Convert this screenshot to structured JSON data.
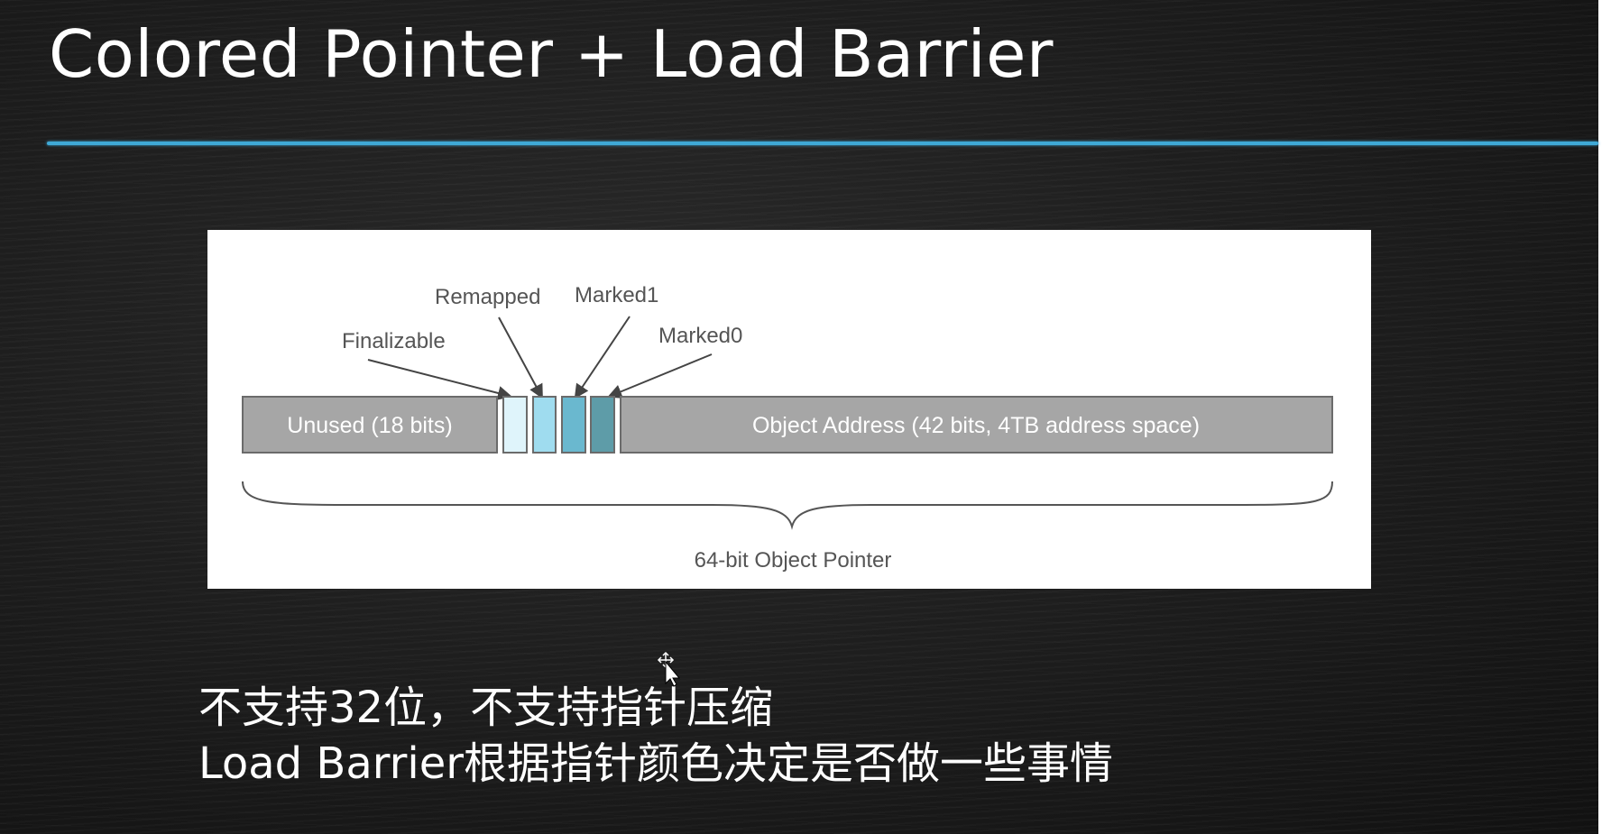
{
  "slide": {
    "title": "Colored Pointer + Load Barrier",
    "accent_color": "#3fa9d6",
    "diagram": {
      "segments": {
        "unused": "Unused (18 bits)",
        "object_address": "Object Address (42 bits, 4TB address space)"
      },
      "flag_bits": [
        {
          "label": "Finalizable",
          "color": "#dff4fb"
        },
        {
          "label": "Remapped",
          "color": "#9fdcef"
        },
        {
          "label": "Marked1",
          "color": "#6ab8cf"
        },
        {
          "label": "Marked0",
          "color": "#5e9ca8"
        }
      ],
      "brace_label": "64-bit Object Pointer"
    },
    "notes": [
      "不支持32位，不支持指针压缩",
      "Load Barrier根据指针颜色决定是否做一些事情"
    ]
  }
}
